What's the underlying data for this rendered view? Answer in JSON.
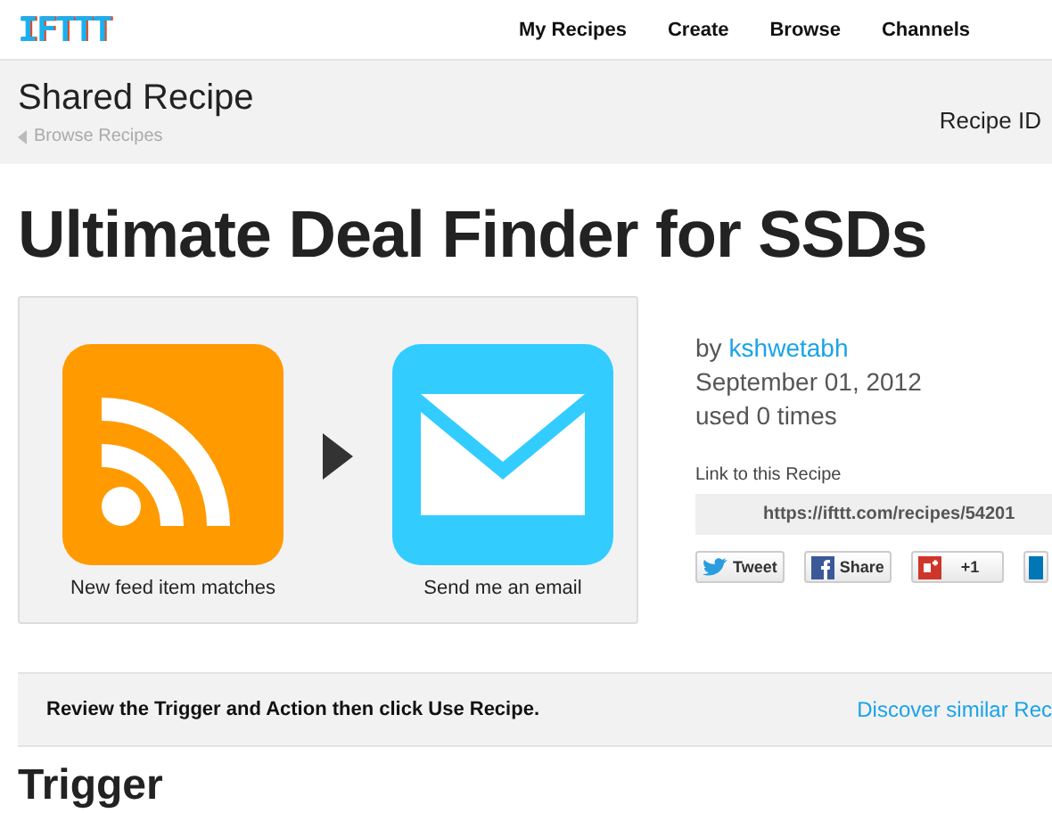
{
  "header": {
    "logo": "IFTTT",
    "nav": [
      {
        "label": "My Recipes"
      },
      {
        "label": "Create"
      },
      {
        "label": "Browse"
      },
      {
        "label": "Channels"
      }
    ]
  },
  "page_header": {
    "title": "Shared Recipe",
    "back_link": "Browse Recipes",
    "recipe_id_label": "Recipe ID"
  },
  "recipe": {
    "title": "Ultimate Deal Finder for SSDs",
    "trigger": {
      "caption": "New feed item matches"
    },
    "action": {
      "caption": "Send me an email"
    }
  },
  "meta": {
    "by": "by",
    "author": "kshwetabh",
    "date": "September 01, 2012",
    "usage": "used 0 times",
    "link_label": "Link to this Recipe",
    "link_url": "https://ifttt.com/recipes/54201"
  },
  "share_buttons": [
    {
      "label": "Tweet",
      "kind": "twitter"
    },
    {
      "label": "Share",
      "kind": "facebook"
    },
    {
      "label": "+1",
      "kind": "google"
    }
  ],
  "banner": {
    "message": "Review the Trigger and Action then click Use Recipe.",
    "link": "Discover similar Rec"
  },
  "section_heading": "Trigger"
}
